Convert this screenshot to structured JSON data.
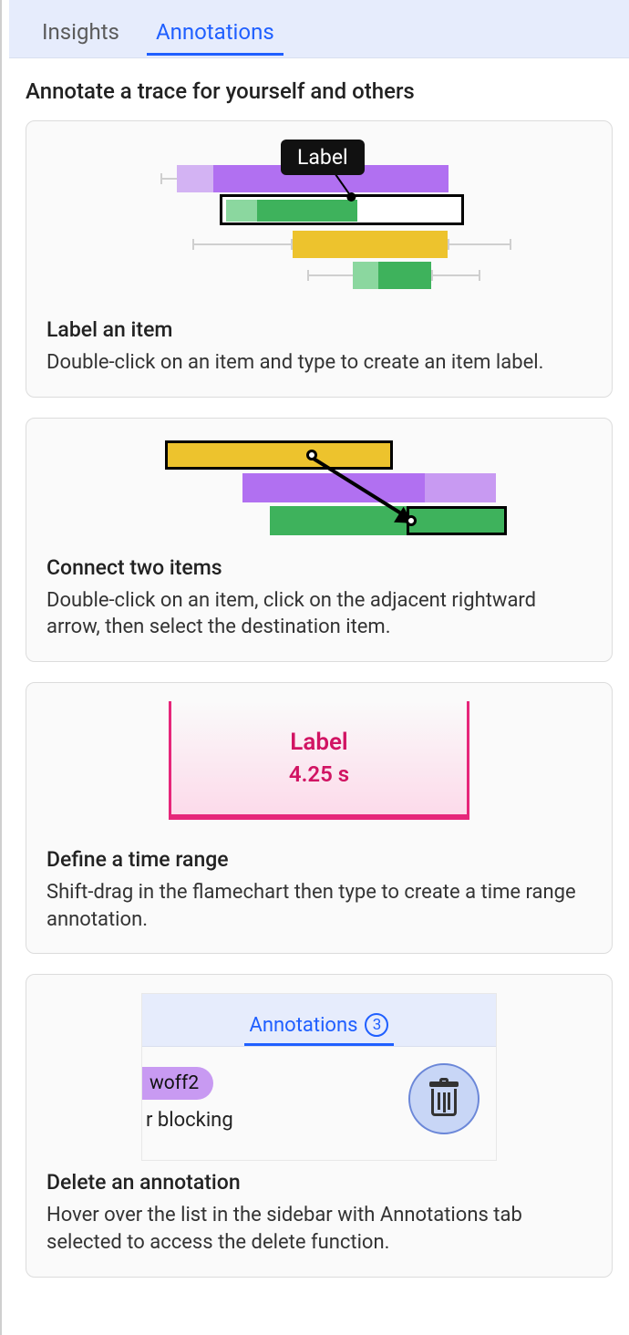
{
  "tabs": {
    "insights": "Insights",
    "annotations": "Annotations"
  },
  "heading": "Annotate a trace for yourself and others",
  "card1": {
    "tooltip": "Label",
    "title": "Label an item",
    "body": "Double-click on an item and type to create an item label."
  },
  "card2": {
    "title": "Connect two items",
    "body": "Double-click on an item, click on the adjacent rightward arrow, then select the destination item."
  },
  "card3": {
    "range_label": "Label",
    "range_value": "4.25 s",
    "title": "Define a time range",
    "body": "Shift-drag in the flamechart then type to create a time range annotation."
  },
  "card4": {
    "panel_tab": "Annotations",
    "panel_count": "3",
    "chip": "woff2",
    "row_text": "r blocking",
    "title": "Delete an annotation",
    "body": "Hover over the list in the sidebar with Annotations tab selected to access the delete function."
  }
}
